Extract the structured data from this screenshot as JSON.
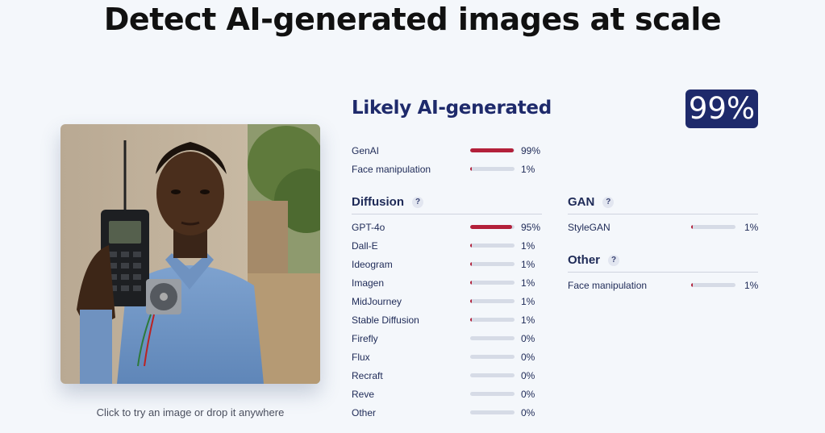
{
  "page": {
    "title": "Detect AI-generated images at scale"
  },
  "upload": {
    "hint": "Click to try an image or drop it anywhere"
  },
  "result": {
    "verdict": "Likely AI-generated",
    "score": "99%",
    "accent_color": "#b3203a",
    "track_color": "#d6dbe6",
    "top": [
      {
        "label": "GenAI",
        "pct": "99%",
        "value": 0.99
      },
      {
        "label": "Face manipulation",
        "pct": "1%",
        "value": 0.01
      }
    ]
  },
  "diffusion": {
    "heading": "Diffusion",
    "help": "?",
    "items": [
      {
        "label": "GPT-4o",
        "pct": "95%",
        "value": 0.95
      },
      {
        "label": "Dall-E",
        "pct": "1%",
        "value": 0.01
      },
      {
        "label": "Ideogram",
        "pct": "1%",
        "value": 0.01
      },
      {
        "label": "Imagen",
        "pct": "1%",
        "value": 0.01
      },
      {
        "label": "MidJourney",
        "pct": "1%",
        "value": 0.01
      },
      {
        "label": "Stable Diffusion",
        "pct": "1%",
        "value": 0.01
      },
      {
        "label": "Firefly",
        "pct": "0%",
        "value": 0
      },
      {
        "label": "Flux",
        "pct": "0%",
        "value": 0
      },
      {
        "label": "Recraft",
        "pct": "0%",
        "value": 0
      },
      {
        "label": "Reve",
        "pct": "0%",
        "value": 0
      },
      {
        "label": "Other",
        "pct": "0%",
        "value": 0
      }
    ]
  },
  "gan": {
    "heading": "GAN",
    "help": "?",
    "items": [
      {
        "label": "StyleGAN",
        "pct": "1%",
        "value": 0.01
      }
    ]
  },
  "other": {
    "heading": "Other",
    "help": "?",
    "items": [
      {
        "label": "Face manipulation",
        "pct": "1%",
        "value": 0.01
      }
    ]
  }
}
